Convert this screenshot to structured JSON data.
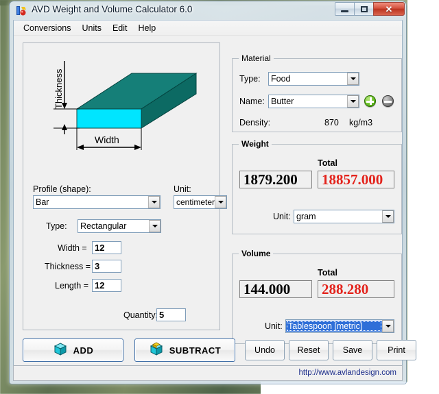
{
  "window": {
    "title": "AVD Weight and Volume Calculator 6.0",
    "app_icon": "app-icon",
    "minimize_label": "",
    "maximize_label": "",
    "close_label": "✕"
  },
  "menubar": {
    "items": [
      {
        "label": "Conversions"
      },
      {
        "label": "Units"
      },
      {
        "label": "Edit"
      },
      {
        "label": "Help"
      }
    ]
  },
  "diagram": {
    "thickness_label": "Thickness",
    "width_label": "Width",
    "face_color": "#00e5ff",
    "body_color": "#0e7b74",
    "top_color": "#157f78",
    "side_color": "#0c6a63"
  },
  "shape": {
    "profile_label": "Profile (shape):",
    "profile_value": "Bar",
    "unit_label": "Unit:",
    "unit_value": "centimeter",
    "type_label": "Type:",
    "type_value": "Rectangular",
    "width_label": "Width =",
    "width_value": "12",
    "thickness_label": "Thickness =",
    "thickness_value": "3",
    "length_label": "Length =",
    "length_value": "12",
    "quantity_label": "Quantity:",
    "quantity_value": "5"
  },
  "material": {
    "group_title": "Material",
    "type_label": "Type:",
    "type_value": "Food",
    "name_label": "Name:",
    "name_value": "Butter",
    "density_label": "Density:",
    "density_value": "870",
    "density_units": "kg/m3",
    "add_icon": "plus-circle-icon",
    "remove_icon": "minus-circle-icon"
  },
  "weight": {
    "group_title": "Weight",
    "total_caption": "Total",
    "value": "1879.200",
    "total_value": "18857.000",
    "total_color": "#e3231c",
    "unit_label": "Unit:",
    "unit_value": "gram"
  },
  "volume": {
    "group_title": "Volume",
    "total_caption": "Total",
    "value": "144.000",
    "total_value": "288.280",
    "total_color": "#e3231c",
    "unit_label": "Unit:",
    "unit_value": "Tablespoon [metric]"
  },
  "actions": {
    "add_label": "ADD",
    "add_icon": "cube-icon",
    "subtract_label": "SUBTRACT",
    "subtract_icon": "cube-open-icon",
    "undo_label": "Undo",
    "reset_label": "Reset",
    "save_label": "Save",
    "print_label": "Print"
  },
  "status": {
    "website": "http://www.avlandesign.com"
  }
}
